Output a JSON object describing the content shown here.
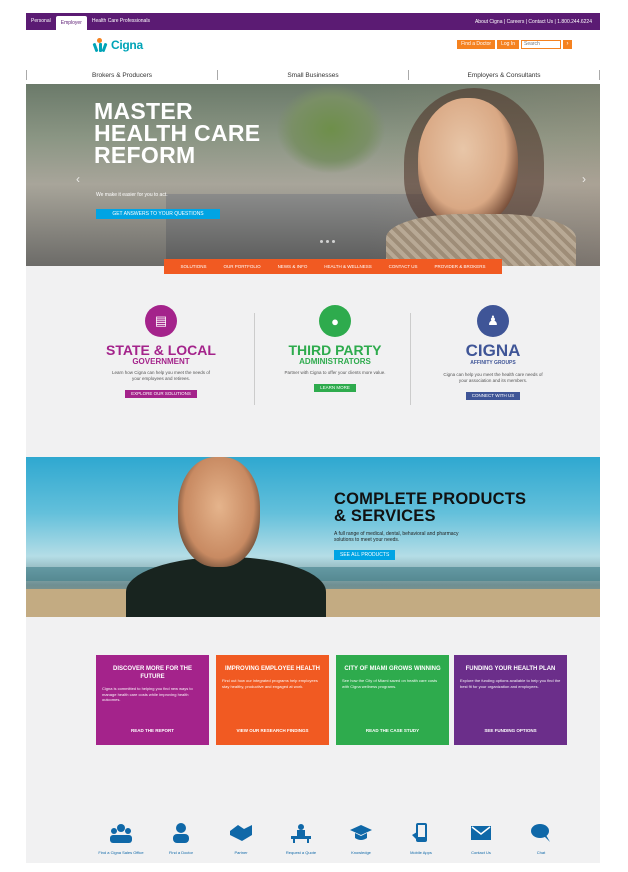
{
  "topbar": {
    "tabs": [
      "Personal",
      "Employer",
      "Health Care Professionals"
    ],
    "utility": "About Cigna | Careers | Contact Us | 1.800.244.6224"
  },
  "header": {
    "logo_text": "Cigna",
    "buttons": [
      "Find a Doctor",
      "Log In"
    ],
    "search_placeholder": "Search",
    "nav": [
      "Brokers & Producers",
      "Small Businesses",
      "Employers & Consultants"
    ]
  },
  "hero": {
    "headline": [
      "MASTER",
      "HEALTH CARE",
      "REFORM"
    ],
    "sub": "We make it easier for you to act.",
    "cta": "GET ANSWERS TO YOUR QUESTIONS",
    "tabs": [
      "SOLUTIONS",
      "OUR PORTFOLIO",
      "NEWS & INFO",
      "HEALTH & WELLNESS",
      "CONTACT US",
      "PROVIDER & BROKERS"
    ]
  },
  "partners": [
    {
      "title": "STATE & LOCAL",
      "subtitle": "GOVERNMENT",
      "text": "Learn how Cigna can help you meet the needs of your employees and retirees.",
      "button": "EXPLORE OUR SOLUTIONS",
      "color": "#a4238b",
      "icon": "building-icon"
    },
    {
      "title": "THIRD PARTY",
      "subtitle": "ADMINISTRATORS",
      "text": "Partner with Cigna to offer your clients more value.",
      "button": "LEARN MORE",
      "color": "#2eab4d",
      "icon": "user-icon"
    },
    {
      "title": "CIGNA",
      "subtitle": "AFFINITY GROUPS",
      "text": "Cigna can help you meet the health care needs of your association and its members.",
      "button": "CONNECT WITH US",
      "color": "#3f5597",
      "icon": "group-icon"
    }
  ],
  "products": {
    "headline": [
      "COMPLETE PRODUCTS",
      "& SERVICES"
    ],
    "text": "A full range of medical, dental, behavioral and pharmacy solutions to meet your needs.",
    "button": "SEE ALL PRODUCTS"
  },
  "tiles": [
    {
      "title": "DISCOVER MORE FOR THE FUTURE",
      "text": "Cigna is committed to helping you find new ways to manage health care costs while improving health outcomes.",
      "link": "READ THE REPORT",
      "color": "#a4238b"
    },
    {
      "title": "IMPROVING EMPLOYEE HEALTH",
      "text": "Find out how our integrated programs help employees stay healthy, productive and engaged at work.",
      "link": "VIEW OUR RESEARCH FINDINGS",
      "color": "#f15a22"
    },
    {
      "title": "CITY OF MIAMI GROWS WINNING",
      "text": "See how the City of Miami saved on health care costs with Cigna wellness programs.",
      "link": "READ THE CASE STUDY",
      "color": "#2eab4d"
    },
    {
      "title": "FUNDING YOUR HEALTH PLAN",
      "text": "Explore the funding options available to help you find the best fit for your organization and employees.",
      "link": "SEE FUNDING OPTIONS",
      "color": "#6b2e8a"
    }
  ],
  "icons": [
    {
      "label": "Find a Cigna Sales Office",
      "icon": "group-icon"
    },
    {
      "label": "Find a Doctor",
      "icon": "person-icon"
    },
    {
      "label": "Partner",
      "icon": "handshake-icon"
    },
    {
      "label": "Request a Quote",
      "icon": "desk-icon"
    },
    {
      "label": "Knowledge",
      "icon": "graduation-cap-icon"
    },
    {
      "label": "Mobile Apps",
      "icon": "phone-icon"
    },
    {
      "label": "Contact Us",
      "icon": "envelope-icon"
    },
    {
      "label": "Chat",
      "icon": "chat-icon"
    }
  ]
}
